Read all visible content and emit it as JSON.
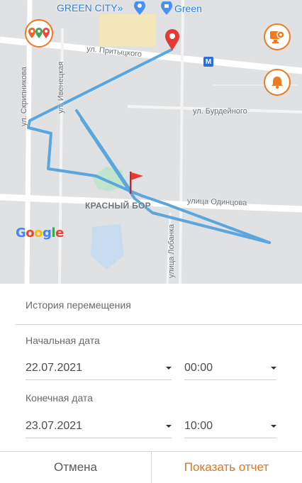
{
  "map": {
    "labels": {
      "poi_top": "GREEN CITY»",
      "poi_green": "Green",
      "street_pritytskogo": "ул. Притыцкого",
      "street_skripnikova": "ул. Скрипникова",
      "street_ivenetskaya": "ул. Ивенецкая",
      "street_burdeinogo": "ул. Бурдейного",
      "street_odintsova": "улица Одинцова",
      "street_lobanka": "улица Лобанка",
      "district": "КРАСНЫЙ БОР",
      "metro": "M"
    },
    "google": [
      "G",
      "o",
      "o",
      "g",
      "l",
      "e"
    ],
    "google_colors": [
      "#4285f4",
      "#ea4335",
      "#fbbc05",
      "#4285f4",
      "#34a853",
      "#ea4335"
    ],
    "route_color": "#5ba6dd",
    "accent_color": "#ec7b22",
    "icons": {
      "markers_button": "map-markers-icon",
      "settings_button": "monitor-settings-icon",
      "alarm_button": "bell-icon",
      "end_marker": "red-pin-icon",
      "start_marker": "red-flag-icon"
    }
  },
  "panel": {
    "title": "История перемещения",
    "start": {
      "label": "Начальная дата",
      "date": "22.07.2021",
      "time": "00:00"
    },
    "end": {
      "label": "Конечная дата",
      "date": "23.07.2021",
      "time": "10:00"
    },
    "cancel_label": "Отмена",
    "submit_label": "Показать отчет"
  }
}
